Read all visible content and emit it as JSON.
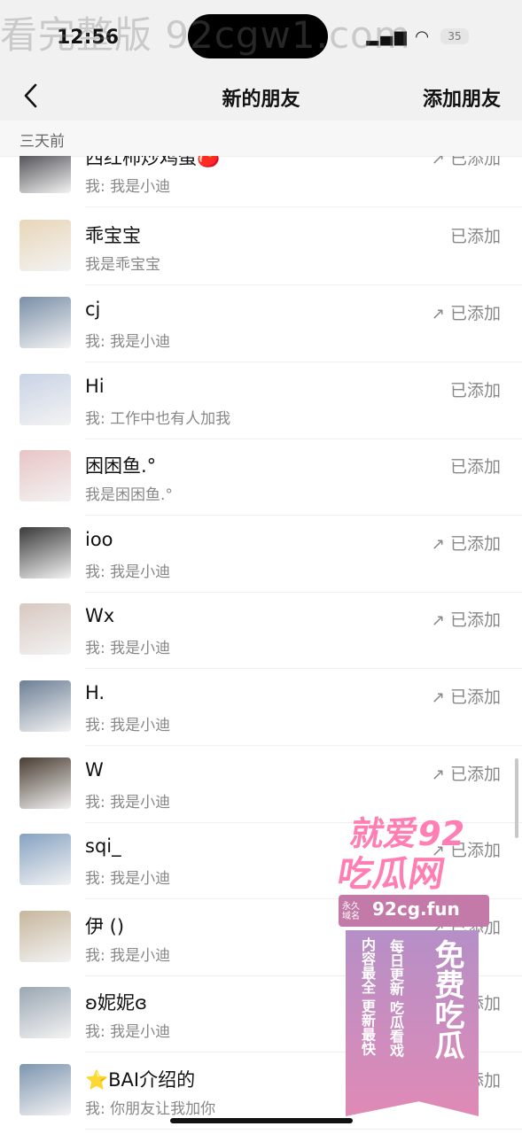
{
  "status_bar": {
    "time": "12:56",
    "signal_icons": "▂▄▆ ◠",
    "battery": "35"
  },
  "watermark": "看完整版 92cgw1.com",
  "navbar": {
    "back_icon": "chevron-left-icon",
    "title": "新的朋友",
    "add_label": "添加朋友"
  },
  "section_label": "三天前",
  "items": [
    {
      "name": "西红柿炒鸡蛋🍅",
      "msg": "我: 我是小迪",
      "status": "已添加",
      "arrow": "↗"
    },
    {
      "name": "乖宝宝",
      "msg": "我是乖宝宝",
      "status": "已添加",
      "arrow": ""
    },
    {
      "name": "cj",
      "msg": "我: 我是小迪",
      "status": "已添加",
      "arrow": "↗"
    },
    {
      "name": "Hi",
      "msg": "我: 工作中也有人加我",
      "status": "已添加",
      "arrow": ""
    },
    {
      "name": "困困鱼.°",
      "msg": "我是困困鱼.°",
      "status": "已添加",
      "arrow": ""
    },
    {
      "name": "ioo",
      "msg": "我: 我是小迪",
      "status": "已添加",
      "arrow": "↗"
    },
    {
      "name": "Wx",
      "msg": "我: 我是小迪",
      "status": "已添加",
      "arrow": "↗"
    },
    {
      "name": "H.",
      "msg": "我: 我是小迪",
      "status": "已添加",
      "arrow": "↗"
    },
    {
      "name": "W",
      "msg": "我: 我是小迪",
      "status": "已添加",
      "arrow": "↗"
    },
    {
      "name": "sqi_",
      "msg": "我: 我是小迪",
      "status": "已添加",
      "arrow": "↗"
    },
    {
      "name": "伊 ()",
      "msg": "我: 我是小迪",
      "status": "已添加",
      "arrow": "↗"
    },
    {
      "name": "ʚ妮妮ɞ",
      "msg": "我: 我是小迪",
      "status": "已添加",
      "arrow": "↗"
    },
    {
      "name": "⭐BAI介绍的",
      "msg": "我: 你朋友让我加你",
      "status": "已添加",
      "arrow": "↗"
    }
  ],
  "avatar_colors": [
    "#2d2d34",
    "#e8d6b8",
    "#7a8fa8",
    "#c9d3e6",
    "#e9c4c4",
    "#3a3a3a",
    "#d8c8c0",
    "#6d7f96",
    "#4a3d32",
    "#86a2c2",
    "#c7b69c",
    "#9aa7b3",
    "#7d95b0"
  ],
  "promo": {
    "line1": "就爱92",
    "line2": "吃瓜网",
    "badge_small": "永久\n域名",
    "url": "92cg.fun",
    "vertical1": "内容最全 更新最快",
    "vertical2": "每日更新 吃瓜看戏",
    "vertical3": "免费吃瓜"
  }
}
